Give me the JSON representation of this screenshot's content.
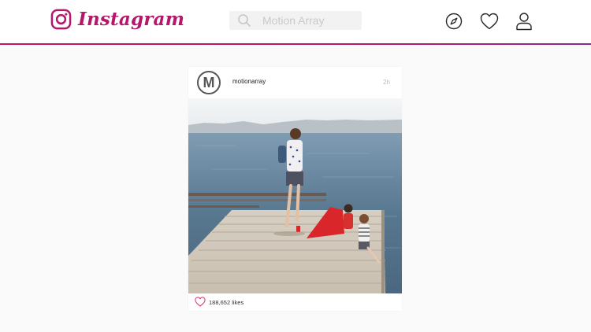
{
  "app": {
    "name": "Instagram",
    "brand_color": "#b5176a"
  },
  "header": {
    "search_placeholder": "Motion Array",
    "icons": [
      "instagram-logo-icon",
      "search-icon",
      "compass-icon",
      "heart-icon",
      "profile-icon"
    ]
  },
  "post": {
    "avatar_letter": "M",
    "username": "motionarray",
    "time": "2h",
    "photo_description": "",
    "likes_text": "188,652 likes",
    "like_icon": "heart-outline-icon",
    "like_icon_color": "#d9487f"
  }
}
